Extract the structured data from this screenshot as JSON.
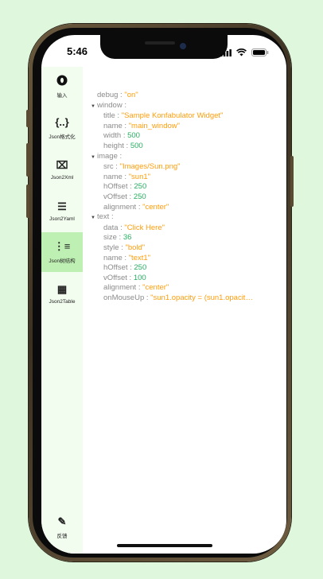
{
  "status": {
    "time": "5:46"
  },
  "sidebar": {
    "items": [
      {
        "label": "输入",
        "icon": "circle-icon",
        "glyph": "●"
      },
      {
        "label": "Json格式化",
        "icon": "braces-icon",
        "glyph": "{..}"
      },
      {
        "label": "Json2Xml",
        "icon": "xml-icon",
        "glyph": "⌧"
      },
      {
        "label": "Json2Yaml",
        "icon": "list-icon",
        "glyph": "☰"
      },
      {
        "label": "Json树结构",
        "icon": "tree-icon",
        "glyph": "⋮≡"
      },
      {
        "label": "Json2Table",
        "icon": "table-icon",
        "glyph": "▦"
      }
    ],
    "feedback": {
      "label": "反馈",
      "icon": "feedback-icon",
      "glyph": "✎"
    },
    "active_index": 4,
    "active_color": "#bff0b3"
  },
  "tree": {
    "debug": {
      "key": "debug",
      "value": "\"on\""
    },
    "window": {
      "key": "window",
      "title": {
        "key": "title",
        "value": "\"Sample Konfabulator Widget\""
      },
      "name": {
        "key": "name",
        "value": "\"main_window\""
      },
      "width": {
        "key": "width",
        "value": "500"
      },
      "height": {
        "key": "height",
        "value": "500"
      }
    },
    "image": {
      "key": "image",
      "src": {
        "key": "src",
        "value": "\"Images/Sun.png\""
      },
      "name": {
        "key": "name",
        "value": "\"sun1\""
      },
      "hOffset": {
        "key": "hOffset",
        "value": "250"
      },
      "vOffset": {
        "key": "vOffset",
        "value": "250"
      },
      "alignment": {
        "key": "alignment",
        "value": "\"center\""
      }
    },
    "text": {
      "key": "text",
      "data": {
        "key": "data",
        "value": "\"Click Here\""
      },
      "size": {
        "key": "size",
        "value": "36"
      },
      "style": {
        "key": "style",
        "value": "\"bold\""
      },
      "name": {
        "key": "name",
        "value": "\"text1\""
      },
      "hOffset": {
        "key": "hOffset",
        "value": "250"
      },
      "vOffset": {
        "key": "vOffset",
        "value": "100"
      },
      "alignment": {
        "key": "alignment",
        "value": "\"center\""
      },
      "onMouseUp": {
        "key": "onMouseUp",
        "value": "\"sun1.opacity = (sun1.opacit…"
      }
    },
    "separator": " : ",
    "colors": {
      "key": "#8b8b8b",
      "string": "#ff9d0a",
      "number": "#27ae60"
    }
  }
}
